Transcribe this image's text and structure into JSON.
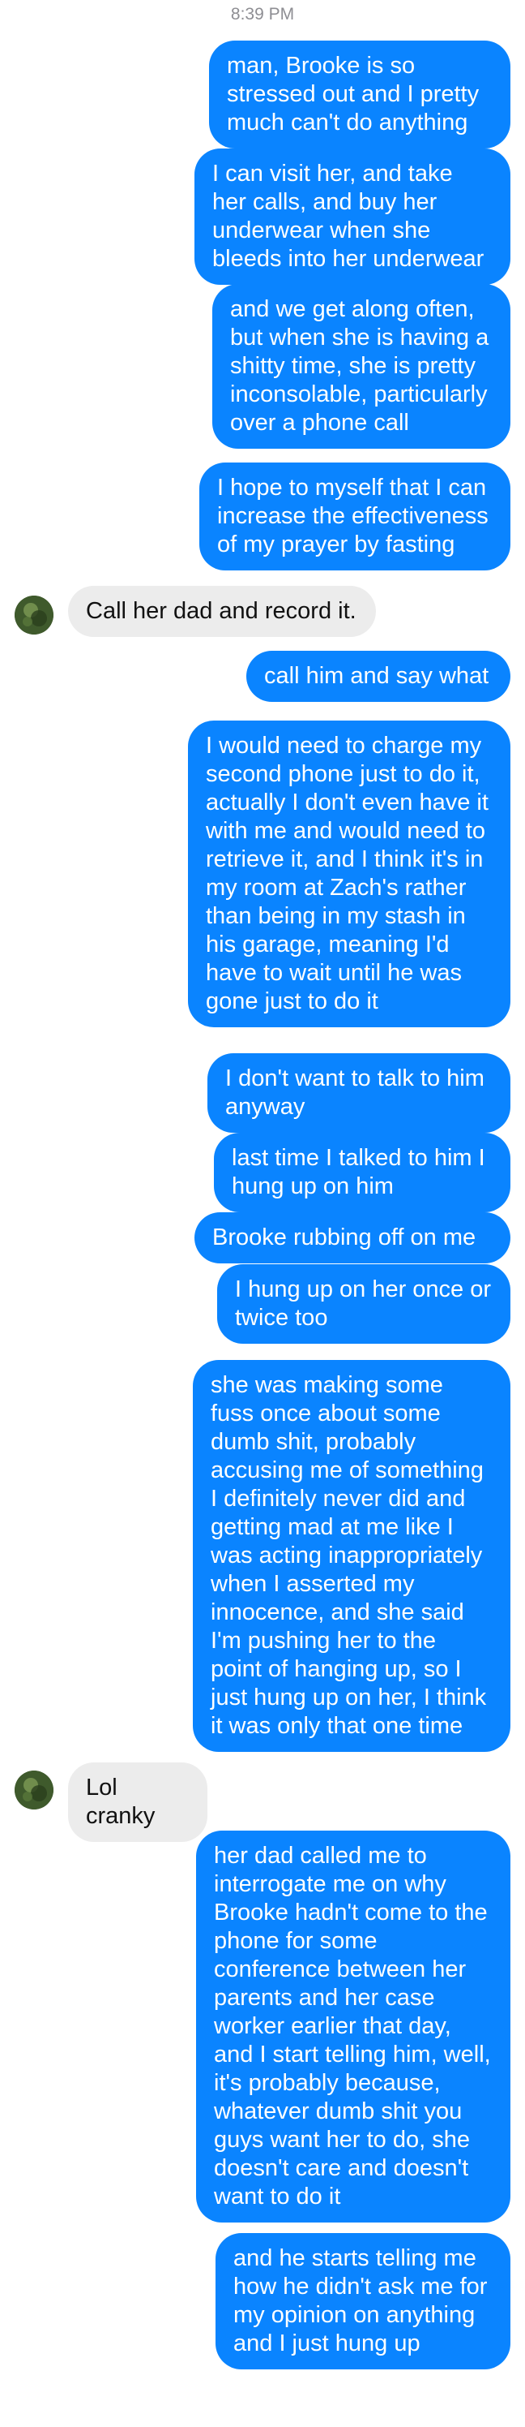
{
  "thread": {
    "timestamp": "8:39 PM",
    "messages": [
      {
        "id": "m1",
        "from": "me",
        "text": "man, Brooke is so stressed out and I pretty much can't do anything"
      },
      {
        "id": "m2",
        "from": "me",
        "text": "I can visit her, and take her calls, and buy her underwear when she bleeds into her underwear"
      },
      {
        "id": "m3",
        "from": "me",
        "text": "and we get along often, but when she is having a shitty time, she is pretty inconsolable, particularly over a phone call"
      },
      {
        "id": "m4",
        "from": "me",
        "text": "I hope to myself that I can increase the effectiveness of my prayer by fasting"
      },
      {
        "id": "m5",
        "from": "them",
        "text": "Call her dad and record it."
      },
      {
        "id": "m6",
        "from": "me",
        "text": "call him and say what"
      },
      {
        "id": "m7",
        "from": "me",
        "text": "I would need to charge my second phone just to do it, actually I don't even have it with me and would need to retrieve it, and I think it's in my room at Zach's rather than being in my stash in his garage, meaning I'd have to wait until he was gone just to do it"
      },
      {
        "id": "m8",
        "from": "me",
        "text": "I don't want to talk to him anyway"
      },
      {
        "id": "m9",
        "from": "me",
        "text": "last time I talked to him I hung up on him"
      },
      {
        "id": "m10",
        "from": "me",
        "text": "Brooke rubbing off on me"
      },
      {
        "id": "m11",
        "from": "me",
        "text": "I hung up on her once or twice too"
      },
      {
        "id": "m12",
        "from": "me",
        "text": "she was making some fuss once about some dumb shit, probably accusing me of something I definitely never did and getting mad at me like I was acting inappropriately when I asserted my innocence, and she said I'm pushing her to the point of hanging up, so I just hung up on her, I think it was only that one time"
      },
      {
        "id": "m13",
        "from": "them",
        "text": "Lol cranky"
      },
      {
        "id": "m14",
        "from": "me",
        "text": "her dad called me to interrogate me on why Brooke hadn't come to the phone for some conference between her parents and her case worker earlier that day, and I start telling him, well, it's probably because, whatever dumb shit you guys want her to do, she doesn't care and doesn't want to do it"
      },
      {
        "id": "m15",
        "from": "me",
        "text": "and he starts telling me how he didn't ask me for my opinion on anything and I just hung up"
      }
    ]
  },
  "colors": {
    "outgoing_bubble": "#0a84ff",
    "incoming_bubble": "#ececec",
    "timestamp": "#8e8e93"
  },
  "icons": {
    "contact_avatar": "avatar-icon"
  }
}
